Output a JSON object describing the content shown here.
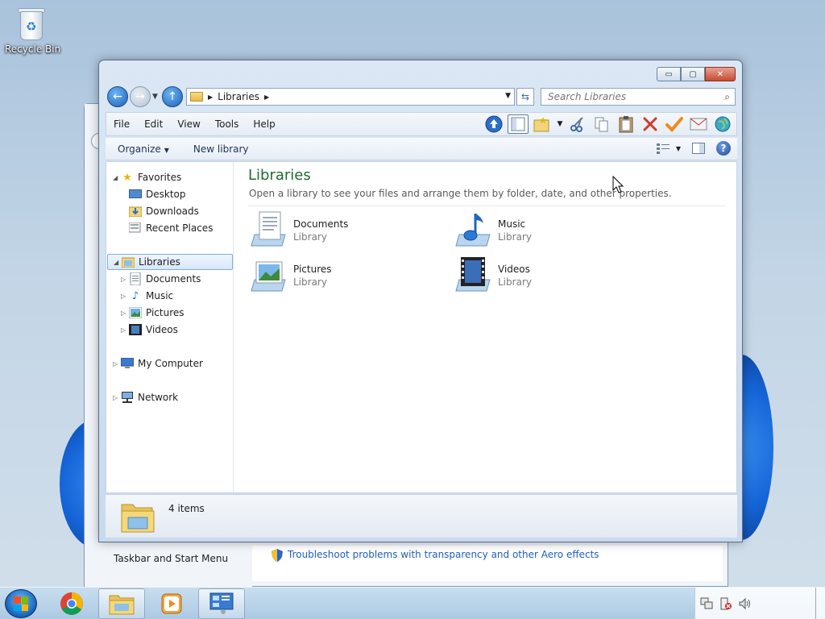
{
  "desktop": {
    "recycle_bin_label": "Recycle Bin"
  },
  "back_window": {
    "left_link": "Taskbar and Start Menu",
    "troubleshoot_link": "Troubleshoot problems with transparency and other Aero effects"
  },
  "window": {
    "caption_buttons": {
      "minimize": "▭",
      "maximize": "▢",
      "close": "✕"
    },
    "address": {
      "breadcrumb": [
        "Libraries"
      ],
      "search_placeholder": "Search Libraries"
    },
    "menu": [
      "File",
      "Edit",
      "View",
      "Tools",
      "Help"
    ],
    "toolbar_icons": [
      "up-arrow-icon",
      "preview-pane-icon",
      "favorites-folder-icon",
      "cut-icon",
      "copy-icon",
      "paste-icon",
      "delete-icon",
      "properties-check-icon",
      "email-icon",
      "globe-icon"
    ],
    "commands": {
      "organize": "Organize",
      "new_library": "New library"
    },
    "nav_pane": {
      "favorites": "Favorites",
      "favorites_items": [
        "Desktop",
        "Downloads",
        "Recent Places"
      ],
      "libraries": "Libraries",
      "libraries_items": [
        "Documents",
        "Music",
        "Pictures",
        "Videos"
      ],
      "my_computer": "My Computer",
      "network": "Network"
    },
    "content": {
      "title": "Libraries",
      "subtitle": "Open a library to see your files and arrange them by folder, date, and other properties.",
      "libraries": [
        {
          "name": "Documents",
          "type": "Library",
          "icon": "documents-library-icon"
        },
        {
          "name": "Music",
          "type": "Library",
          "icon": "music-library-icon"
        },
        {
          "name": "Pictures",
          "type": "Library",
          "icon": "pictures-library-icon"
        },
        {
          "name": "Videos",
          "type": "Library",
          "icon": "videos-library-icon"
        }
      ]
    },
    "details": {
      "count": "4 items"
    }
  },
  "taskbar": {
    "buttons": [
      "chrome-icon",
      "explorer-icon",
      "media-player-icon",
      "control-panel-icon"
    ],
    "tray_icons": [
      "network-icon",
      "action-center-icon",
      "volume-icon"
    ]
  },
  "colors": {
    "title_green": "#1e6b2f",
    "link_blue": "#1f5fbf"
  }
}
